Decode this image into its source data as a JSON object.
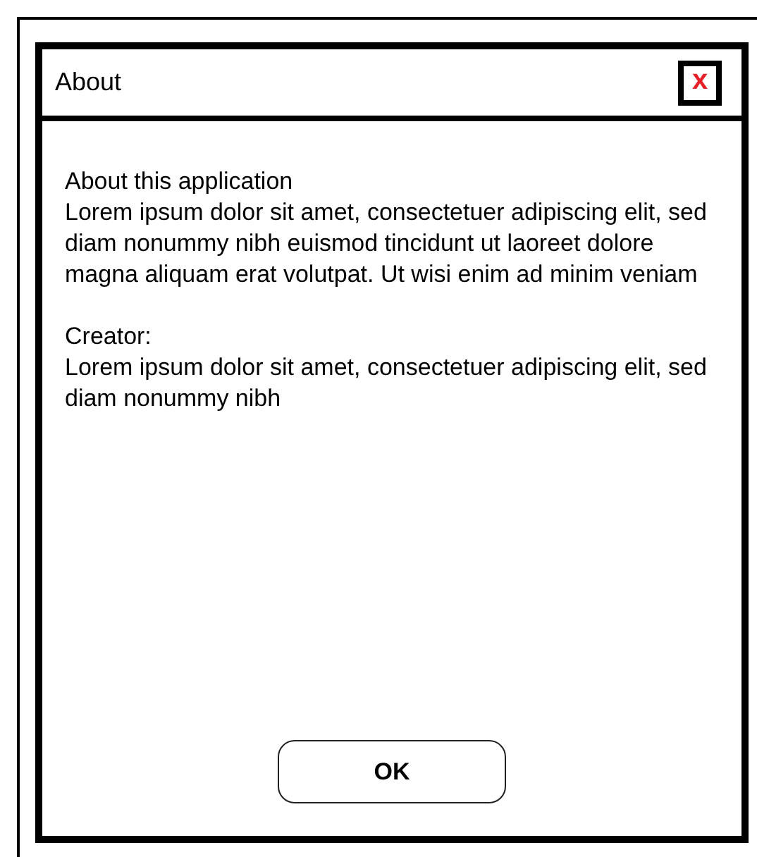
{
  "window": {
    "title": "About",
    "close_label": "x"
  },
  "sections": [
    {
      "heading": "About this application",
      "text": "Lorem ipsum dolor sit amet, consectetuer adipiscing elit, sed diam nonummy nibh euismod tincidunt ut laoreet dolore magna aliquam erat volutpat. Ut wisi enim ad minim veniam"
    },
    {
      "heading": "Creator:",
      "text": "Lorem ipsum dolor sit amet, consectetuer adipiscing elit, sed diam nonummy nibh"
    }
  ],
  "buttons": [
    "OK"
  ]
}
